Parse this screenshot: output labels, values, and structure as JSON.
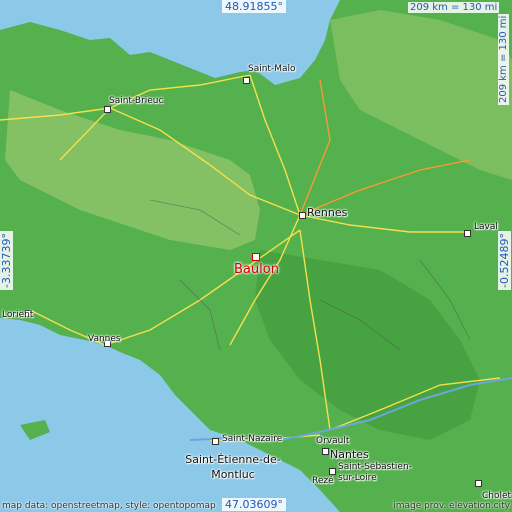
{
  "map": {
    "place_name": "Baulon",
    "coords": {
      "top_lat": "48.91855°",
      "bottom_lat": "47.03609°",
      "left_lon": "-3.33739°",
      "right_lon": "-0.52489°"
    },
    "scale": {
      "horizontal": "209 km = 130 mi",
      "vertical": "209 km = 130 mi"
    },
    "cities": [
      {
        "name": "Saint-Malo",
        "big": false
      },
      {
        "name": "Saint-Brieuc",
        "big": false
      },
      {
        "name": "Rennes",
        "big": true
      },
      {
        "name": "Laval",
        "big": false
      },
      {
        "name": "Lorient",
        "big": false
      },
      {
        "name": "Vannes",
        "big": false
      },
      {
        "name": "Saint-Nazaire",
        "big": false
      },
      {
        "name": "Saint-Étienne-de-Montluc",
        "big": true
      },
      {
        "name": "Orvault",
        "big": false
      },
      {
        "name": "Nantes",
        "big": true
      },
      {
        "name": "Saint-Sébastien-sur-Loire",
        "big": false
      },
      {
        "name": "Rezé",
        "big": false
      },
      {
        "name": "Cholet",
        "big": false
      }
    ],
    "footer_left": "map data: openstreetmap, style: opentopomap",
    "footer_right": "image prov. elevation.city",
    "colors": {
      "sea": "#8cc8e8",
      "land": "#4caf4a",
      "highlands": "#a8c878",
      "roads": "#f4e04a",
      "place": "#d40000"
    }
  }
}
